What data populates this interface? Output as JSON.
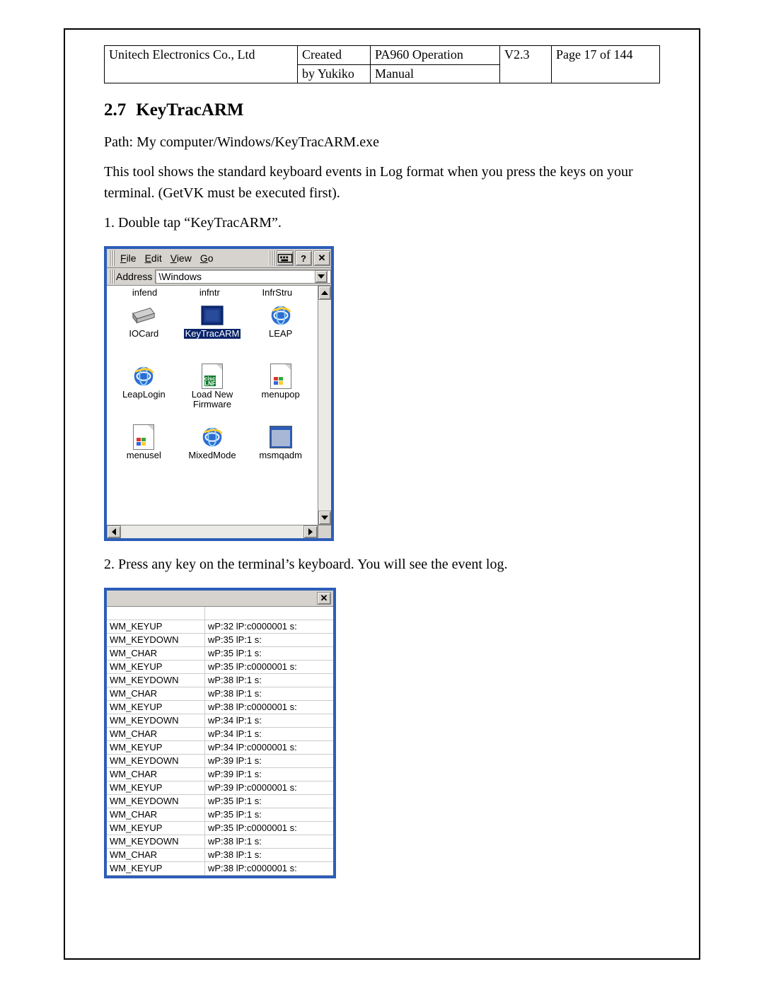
{
  "header": {
    "company": "Unitech Electronics Co., Ltd",
    "created_l1": "Created",
    "created_l2": "by Yukiko",
    "manual_l1": "PA960 Operation",
    "manual_l2": "Manual",
    "version": "V2.3",
    "page": "Page 17 of 144"
  },
  "section": {
    "number": "2.7",
    "title": "KeyTracARM"
  },
  "path_line": "Path: My computer/Windows/KeyTracARM.exe",
  "desc_line": "This tool shows the standard keyboard events in Log format when you press the keys on your terminal. (GetVK must be executed first).",
  "step1": "1. Double tap “KeyTracARM”.",
  "step2": "2. Press any key on the terminal’s keyboard. You will see the event log.",
  "explorer": {
    "menu": {
      "file": "File",
      "edit": "Edit",
      "view": "View",
      "go": "Go"
    },
    "address_label": "Address",
    "address_value": "\\Windows",
    "top_labels": [
      "infend",
      "infntr",
      "InfrStru"
    ],
    "icons": [
      {
        "label": "IOCard",
        "type": "card",
        "selected": false
      },
      {
        "label": "KeyTracARM",
        "type": "exe",
        "selected": true
      },
      {
        "label": "LEAP",
        "type": "ie",
        "selected": false
      },
      {
        "label": "LeapLogin",
        "type": "ie",
        "selected": false
      },
      {
        "label": "Load New Firmware",
        "type": "lnf",
        "selected": false
      },
      {
        "label": "menupop",
        "type": "docwin",
        "selected": false
      },
      {
        "label": "menusel",
        "type": "docwin",
        "selected": false
      },
      {
        "label": "MixedMode",
        "type": "ie",
        "selected": false
      },
      {
        "label": "msmqadm",
        "type": "win",
        "selected": false
      }
    ]
  },
  "log": {
    "cutoff": {
      "c1": "",
      "c2": ""
    },
    "rows": [
      {
        "evt": "WM_KEYUP",
        "params": "wP:32 lP:c0000001 s:"
      },
      {
        "evt": "WM_KEYDOWN",
        "params": "wP:35 lP:1 s:"
      },
      {
        "evt": "WM_CHAR",
        "params": "wP:35 lP:1 s:"
      },
      {
        "evt": "WM_KEYUP",
        "params": "wP:35 lP:c0000001 s:"
      },
      {
        "evt": "WM_KEYDOWN",
        "params": "wP:38 lP:1 s:"
      },
      {
        "evt": "WM_CHAR",
        "params": "wP:38 lP:1 s:"
      },
      {
        "evt": "WM_KEYUP",
        "params": "wP:38 lP:c0000001 s:"
      },
      {
        "evt": "WM_KEYDOWN",
        "params": "wP:34 lP:1 s:"
      },
      {
        "evt": "WM_CHAR",
        "params": "wP:34 lP:1 s:"
      },
      {
        "evt": "WM_KEYUP",
        "params": "wP:34 lP:c0000001 s:"
      },
      {
        "evt": "WM_KEYDOWN",
        "params": "wP:39 lP:1 s:"
      },
      {
        "evt": "WM_CHAR",
        "params": "wP:39 lP:1 s:"
      },
      {
        "evt": "WM_KEYUP",
        "params": "wP:39 lP:c0000001 s:"
      },
      {
        "evt": "WM_KEYDOWN",
        "params": "wP:35 lP:1 s:"
      },
      {
        "evt": "WM_CHAR",
        "params": "wP:35 lP:1 s:"
      },
      {
        "evt": "WM_KEYUP",
        "params": "wP:35 lP:c0000001 s:"
      },
      {
        "evt": "WM_KEYDOWN",
        "params": "wP:38 lP:1 s:"
      },
      {
        "evt": "WM_CHAR",
        "params": "wP:38 lP:1 s:"
      },
      {
        "evt": "WM_KEYUP",
        "params": "wP:38 lP:c0000001 s:"
      }
    ]
  }
}
